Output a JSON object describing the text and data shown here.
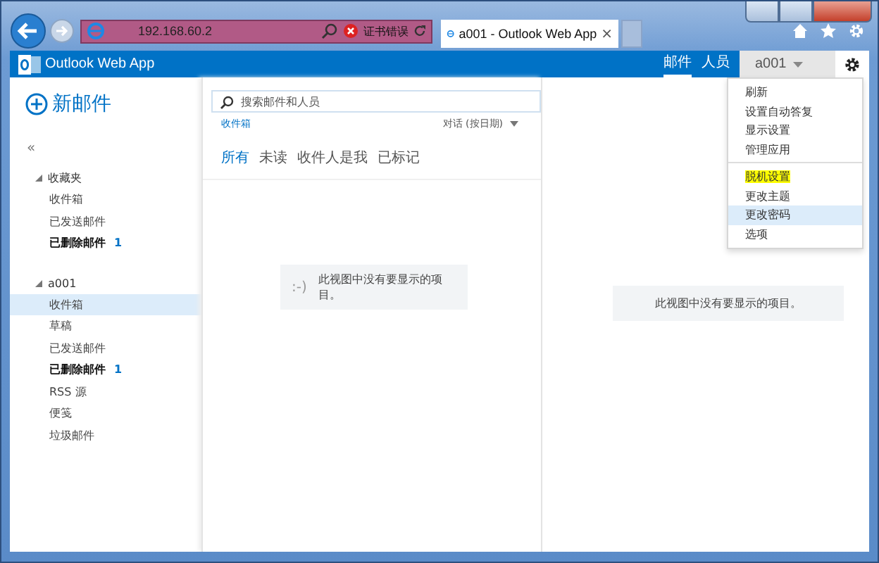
{
  "browser": {
    "address": "192.168.60.2",
    "cert_error": "证书错误",
    "tabs": [
      {
        "title": "a001 - Outlook Web App",
        "selected": true,
        "close": "×"
      }
    ]
  },
  "app": {
    "title": "Outlook Web App",
    "nav": [
      {
        "label": "邮件",
        "selected": true
      },
      {
        "label": "人员",
        "selected": false
      }
    ],
    "user": "a001"
  },
  "new_mail": "新邮件",
  "collapse": "«",
  "folder_groups": [
    {
      "name": "收藏夹",
      "expanded": true,
      "children": [
        {
          "name": "收件箱",
          "selected": false,
          "bold": false
        },
        {
          "name": "已发送邮件",
          "selected": false,
          "bold": false
        },
        {
          "name": "已删除邮件",
          "selected": false,
          "bold": true,
          "count": "1"
        }
      ]
    },
    {
      "name": "a001",
      "expanded": true,
      "children": [
        {
          "name": "收件箱",
          "selected": true,
          "bold": false
        },
        {
          "name": "草稿",
          "selected": false,
          "bold": false
        },
        {
          "name": "已发送邮件",
          "selected": false,
          "bold": false
        },
        {
          "name": "已删除邮件",
          "selected": false,
          "bold": true,
          "count": "1"
        },
        {
          "name": "RSS 源",
          "selected": false,
          "bold": false
        },
        {
          "name": "便笺",
          "selected": false,
          "bold": false
        },
        {
          "name": "垃圾邮件",
          "selected": false,
          "bold": false
        }
      ]
    }
  ],
  "search": {
    "placeholder": "搜索邮件和人员"
  },
  "list": {
    "folder": "收件箱",
    "sort": "对话 (按日期)",
    "filters": [
      {
        "label": "所有",
        "selected": true
      },
      {
        "label": "未读",
        "selected": false
      },
      {
        "label": "收件人是我",
        "selected": false
      },
      {
        "label": "已标记",
        "selected": false
      }
    ],
    "empty": {
      "face": ":-)",
      "message": "此视图中没有要显示的项目。"
    }
  },
  "reading": {
    "message": "此视图中没有要显示的项目。"
  },
  "menu": {
    "items": [
      {
        "label": "刷新",
        "selected": false,
        "highlighted": false,
        "separator_before": false
      },
      {
        "label": "设置自动答复",
        "selected": false,
        "highlighted": false,
        "separator_before": false
      },
      {
        "label": "显示设置",
        "selected": false,
        "highlighted": false,
        "separator_before": false
      },
      {
        "label": "管理应用",
        "selected": false,
        "highlighted": false,
        "separator_before": false
      },
      {
        "label": "脱机设置",
        "selected": false,
        "highlighted": true,
        "separator_before": true
      },
      {
        "label": "更改主题",
        "selected": false,
        "highlighted": false,
        "separator_before": false
      },
      {
        "label": "更改密码",
        "selected": true,
        "highlighted": false,
        "separator_before": false
      },
      {
        "label": "选项",
        "selected": false,
        "highlighted": false,
        "separator_before": false
      }
    ]
  }
}
